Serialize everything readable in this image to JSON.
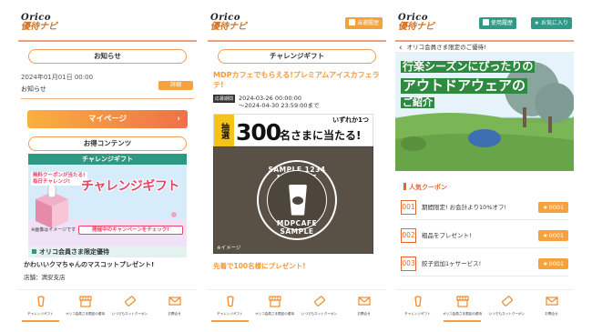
{
  "screen1": {
    "logo_brand": "Orico",
    "logo_sub": "優待ナビ",
    "notice_section": "お知らせ",
    "notice_date": "2024年01月01日 00:00",
    "notice_title": "お知らせ",
    "detail_button": "詳細",
    "mypage_button": "マイページ",
    "mypage_chevron": "›",
    "deals_section": "お得コンテンツ",
    "challenge_bar": "チャレンジギフト",
    "banner_small": "無料クーポンが当たる!\n毎日チャレンジ!",
    "banner_title": "チャレンジギフト",
    "banner_note": "※画像はイメージです",
    "banner_campaign": "開催中のキャンペーンをチェック!",
    "member_bar": "オリコ会員さま限定優待",
    "offer_title": "かわいいクマちゃんのマスコットプレゼント!",
    "store": "店舗：満安支店"
  },
  "screen2": {
    "logo_brand": "Orico",
    "logo_sub": "優待ナビ",
    "winners_button": "当選履歴",
    "section": "チャレンジギフト",
    "article_title": "MDPカフェでもらえる!プレミアムアイスカフェラテ!",
    "period_badge": "応募期間",
    "period_start": "2024-03-26 00:00:00",
    "period_end": "～2024-04-30 23:59:00まで",
    "lottery": "抽選",
    "count": "300",
    "win_text": "名さまに当たる!",
    "one_each": "いずれか1つ",
    "seal_top": "SAMPLE 1234 MDPCAFE",
    "seal_bottom": "MDPCAFE SAMPLE",
    "image_note": "※イメージ",
    "next_title": "先着で100名様にプレゼント!"
  },
  "screen3": {
    "logo_brand": "Orico",
    "logo_sub": "優待ナビ",
    "history_button": "使用履歴",
    "favorites_button": "お気に入り",
    "back_arrow": "‹",
    "back_title": "オリコ会員さま限定のご優待!",
    "hero_line1": "行楽シーズンにぴったりの",
    "hero_line2": "アウトドアウェアの",
    "hero_line3": "ご紹介",
    "coupon_heading": "人気クーポン",
    "coupons": [
      {
        "no": "001",
        "text": "期間限定! お会計より10%オフ!",
        "badge": "0001"
      },
      {
        "no": "002",
        "text": "粗品をプレゼント!",
        "badge": "0001"
      },
      {
        "no": "003",
        "text": "餃子追加1ヶサービス!",
        "badge": "0001"
      }
    ]
  },
  "tabbar": {
    "items": [
      "チャレンジギフト",
      "オリコ会員さま限定の優待",
      "いつでもネットクーポン",
      "お問合せ"
    ]
  },
  "colors": {
    "orange": "#f4a23c",
    "teal": "#2e9882",
    "accent_red": "#e2672d",
    "dark": "#222222"
  },
  "icons": [
    "lottery-cup-icon",
    "store-icon",
    "ticket-icon",
    "mail-icon",
    "star-icon",
    "back-chevron-icon"
  ]
}
